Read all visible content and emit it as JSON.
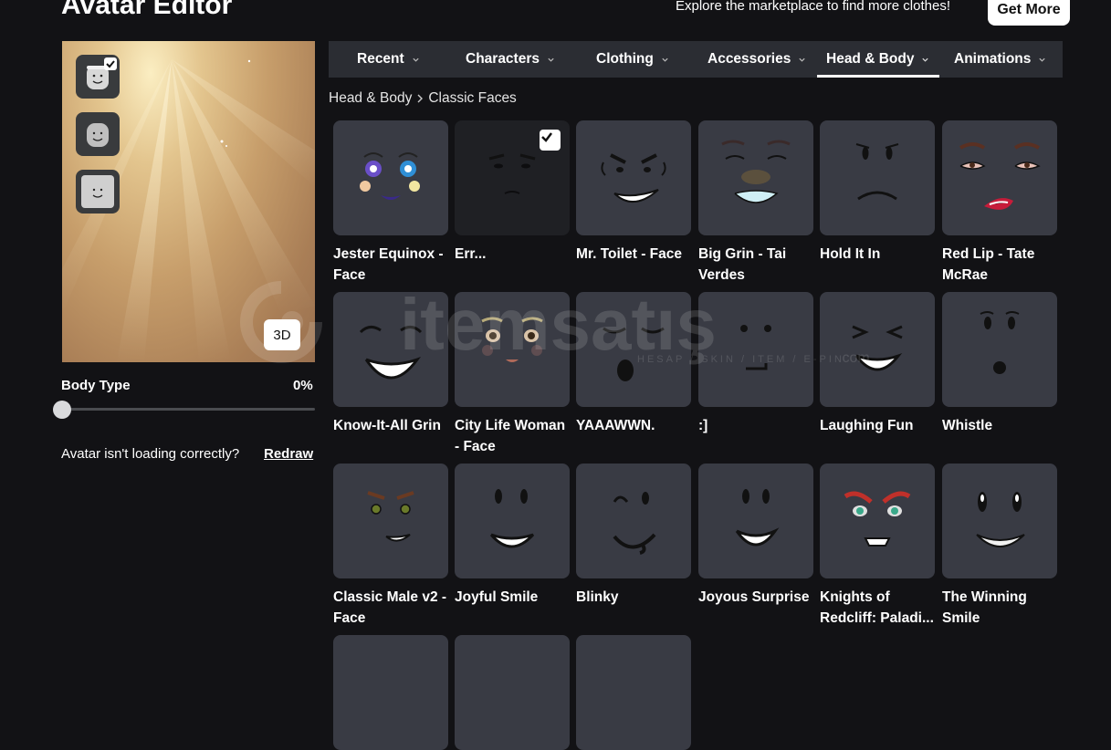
{
  "header": {
    "title": "Avatar Editor",
    "explore_text": "Explore the marketplace to find more clothes!",
    "get_more_label": "Get More"
  },
  "preview": {
    "toggle_3d_label": "3D"
  },
  "body_type": {
    "label": "Body Type",
    "value_text": "0%",
    "value": 0
  },
  "loading_notice": {
    "text": "Avatar isn't loading correctly?",
    "redraw_label": "Redraw"
  },
  "tabs": [
    {
      "label": "Recent"
    },
    {
      "label": "Characters"
    },
    {
      "label": "Clothing"
    },
    {
      "label": "Accessories"
    },
    {
      "label": "Head & Body"
    },
    {
      "label": "Animations"
    }
  ],
  "breadcrumb": {
    "parent": "Head & Body",
    "current": "Classic Faces"
  },
  "items": [
    {
      "name": "Jester Equinox - Face",
      "icon": "jester-face-icon"
    },
    {
      "name": "Err...",
      "icon": "err-face-icon",
      "selected": true
    },
    {
      "name": "Mr. Toilet - Face",
      "icon": "toilet-face-icon"
    },
    {
      "name": "Big Grin - Tai Verdes",
      "icon": "big-grin-face-icon"
    },
    {
      "name": "Hold It In",
      "icon": "hold-face-icon"
    },
    {
      "name": "Red Lip - Tate McRae",
      "icon": "red-lip-face-icon"
    },
    {
      "name": "Know-It-All Grin",
      "icon": "know-it-all-face-icon"
    },
    {
      "name": "City Life Woman - Face",
      "icon": "city-life-face-icon"
    },
    {
      "name": "YAAAWWN.",
      "icon": "yawn-face-icon"
    },
    {
      "name": ":]",
      "icon": "smirk-face-icon"
    },
    {
      "name": "Laughing Fun",
      "icon": "laughing-face-icon"
    },
    {
      "name": "Whistle",
      "icon": "whistle-face-icon"
    },
    {
      "name": "Classic Male v2 - Face",
      "icon": "classic-male-face-icon"
    },
    {
      "name": "Joyful Smile",
      "icon": "joyful-face-icon"
    },
    {
      "name": "Blinky",
      "icon": "blinky-face-icon"
    },
    {
      "name": "Joyous Surprise",
      "icon": "joyous-face-icon"
    },
    {
      "name": "Knights of Redcliff: Paladi...",
      "icon": "paladin-face-icon"
    },
    {
      "name": "The Winning Smile",
      "icon": "winning-face-icon"
    }
  ],
  "watermark": {
    "brand": "itemsatış",
    "tagline": "HESAP / SKIN / ITEM / E-PIN",
    "suffix": ".com"
  },
  "colors": {
    "background": "#121215",
    "tab_bar": "#2b2d33",
    "tile": "#393b44",
    "accent": "#ffffff"
  }
}
